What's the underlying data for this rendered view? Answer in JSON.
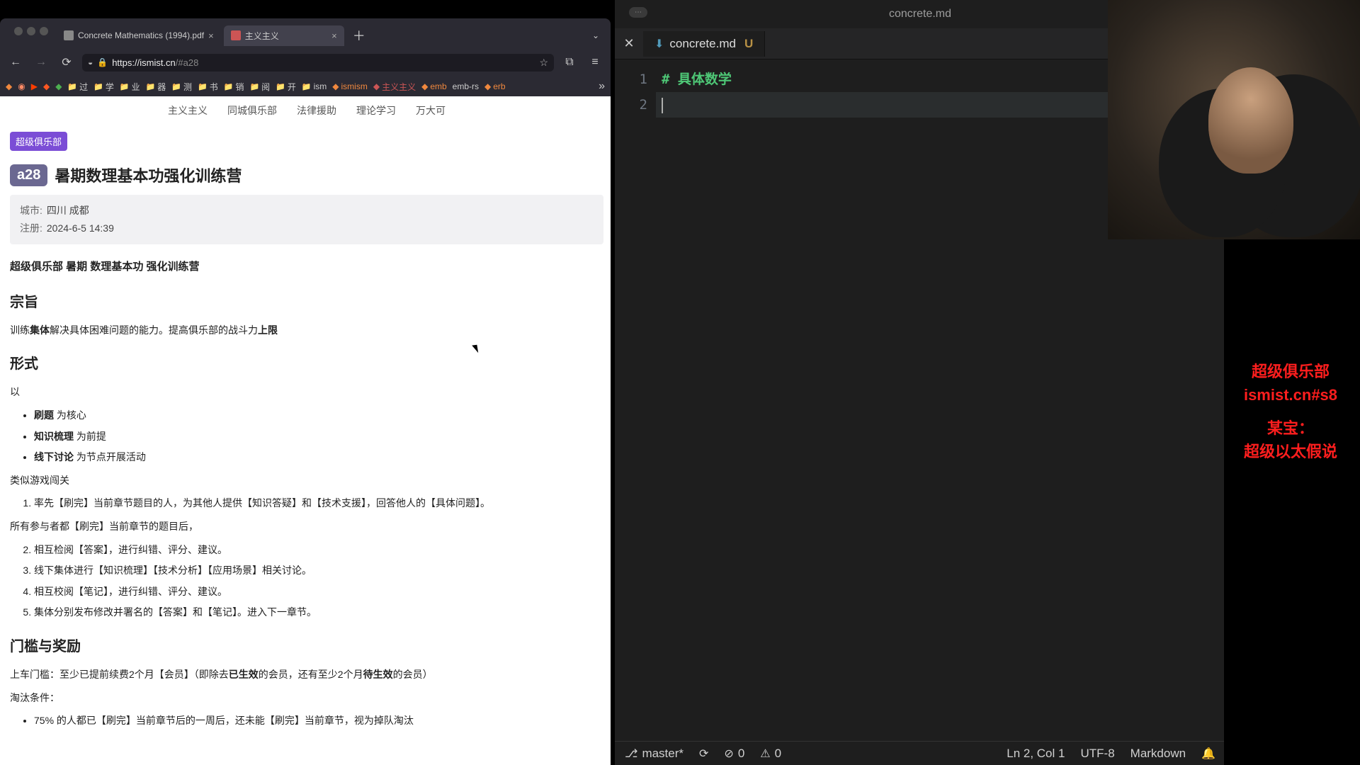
{
  "browser": {
    "tabs": [
      {
        "title": "Concrete Mathematics (1994).pdf",
        "active": false
      },
      {
        "title": "主义主义",
        "active": true
      }
    ],
    "url_host": "https://ismist.cn",
    "url_path": "/#a28",
    "bookmarks": [
      "过",
      "学",
      "业",
      "器",
      "测",
      "书",
      "销",
      "阅",
      "开",
      "ism",
      "ismism",
      "主义主义",
      "emb",
      "emb-rs",
      "erb"
    ],
    "sitenav": [
      "主义主义",
      "同城俱乐部",
      "法律援助",
      "理论学习",
      "万大可"
    ]
  },
  "article": {
    "club_badge": "超级俱乐部",
    "code_badge": "a28",
    "title": "暑期数理基本功强化训练营",
    "meta": {
      "city_label": "城市:",
      "city_value": "四川 成都",
      "reg_label": "注册:",
      "reg_value": "2024-6-5 14:39"
    },
    "subtitle": "超级俱乐部 暑期 数理基本功 强化训练营",
    "h_purpose": "宗旨",
    "purpose_a": "训练",
    "purpose_b": "集体",
    "purpose_c": "解决具体困难问题的能力。提高俱乐部的战斗力",
    "purpose_d": "上限",
    "h_form": "形式",
    "form_intro": "以",
    "form_list": [
      {
        "b": "刷题",
        "t": " 为核心"
      },
      {
        "b": "知识梳理",
        "t": " 为前提"
      },
      {
        "b": "线下讨论",
        "t": " 为节点开展活动"
      }
    ],
    "form_after": "类似游戏闯关",
    "ol1_1": "率先【刷完】当前章节题目的人，为其他人提供【知识答疑】和【技术支援】，回答他人的【具体问题】。",
    "between": "所有参与者都【刷完】当前章节的题目后，",
    "ol2": [
      "相互检阅【答案】，进行纠错、评分、建议。",
      "线下集体进行【知识梳理】【技术分析】【应用场景】相关讨论。",
      "相互校阅【笔记】，进行纠错、评分、建议。",
      "集体分别发布修改并署名的【答案】和【笔记】。进入下一章节。"
    ],
    "h_thresh": "门槛与奖励",
    "thresh_a": "上车门槛：至少已提前续费2个月【会员】（即除去",
    "thresh_b": "已生效",
    "thresh_c": "的会员，还有至少2个月",
    "thresh_d": "待生效",
    "thresh_e": "的会员）",
    "elim_label": "淘汰条件：",
    "elim_1": "75% 的人都已【刷完】当前章节后的一周后，还未能【刷完】当前章节，视为掉队淘汰"
  },
  "vscode": {
    "title": "concrete.md",
    "tab_file": "concrete.md",
    "tab_mod": "U",
    "gutter": [
      "1",
      "2"
    ],
    "code_hash": "#",
    "code_h1": " 具体数学",
    "status": {
      "branch": "master*",
      "err": "0",
      "warn": "0",
      "pos": "Ln 2, Col 1",
      "enc": "UTF-8",
      "lang": "Markdown"
    }
  },
  "overlay": {
    "line1": "超级俱乐部",
    "line2": "ismist.cn#s8",
    "line3": "某宝：",
    "line4": "超级以太假说"
  }
}
